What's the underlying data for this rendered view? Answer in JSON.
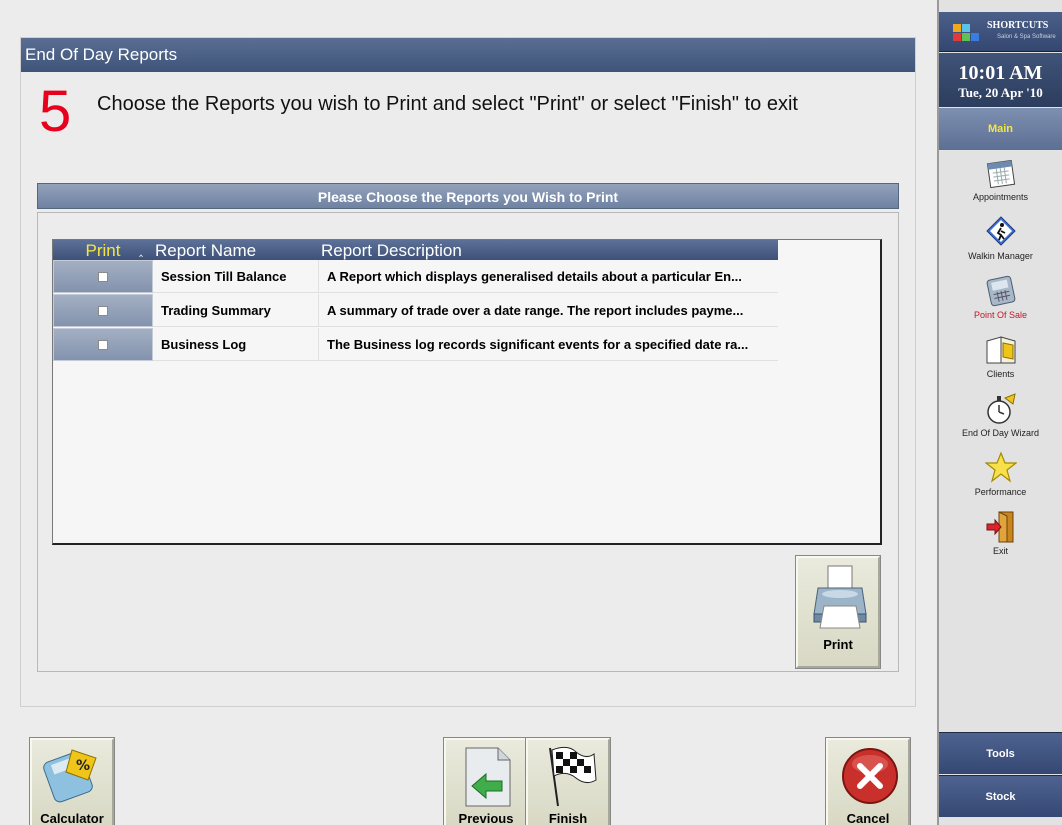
{
  "window": {
    "title": "End Of Day Reports"
  },
  "step": {
    "number": "5",
    "instruction": "Choose the Reports you wish to Print and select \"Print\" or select \"Finish\" to exit"
  },
  "section": {
    "header": "Please Choose the Reports you Wish to Print"
  },
  "grid": {
    "columns": {
      "print": "Print",
      "sort_indicator": "^",
      "name": "Report Name",
      "description": "Report Description"
    },
    "rows": [
      {
        "name": "Session Till Balance",
        "description": "A Report which displays generalised details about a particular En...",
        "checked": false
      },
      {
        "name": "Trading Summary",
        "description": "A summary of trade over a date range. The report includes payme...",
        "checked": false
      },
      {
        "name": "Business Log",
        "description": "The Business log records significant events for a specified date ra...",
        "checked": false
      }
    ]
  },
  "buttons": {
    "print": "Print",
    "calculator": "Calculator",
    "previous": "Previous",
    "finish": "Finish",
    "cancel": "Cancel"
  },
  "sidebar": {
    "logo": {
      "name": "SHORTCUTS",
      "tagline": "Salon & Spa Software"
    },
    "clock": {
      "time": "10:01 AM",
      "date": "Tue, 20 Apr '10"
    },
    "main_label": "Main",
    "items": [
      {
        "label": "Appointments",
        "icon": "calendar-icon"
      },
      {
        "label": "Walkin Manager",
        "icon": "walkin-icon"
      },
      {
        "label": "Point Of Sale",
        "icon": "pos-terminal-icon"
      },
      {
        "label": "Clients",
        "icon": "clients-book-icon"
      },
      {
        "label": "End Of Day Wizard",
        "icon": "stopwatch-icon"
      },
      {
        "label": "Performance",
        "icon": "star-icon"
      },
      {
        "label": "Exit",
        "icon": "exit-door-icon"
      }
    ],
    "bottom": {
      "tools": "Tools",
      "stock": "Stock"
    }
  },
  "colors": {
    "accent_red": "#e8001c",
    "title_bar": "#3f5479",
    "header_yellow": "#f5e642"
  }
}
